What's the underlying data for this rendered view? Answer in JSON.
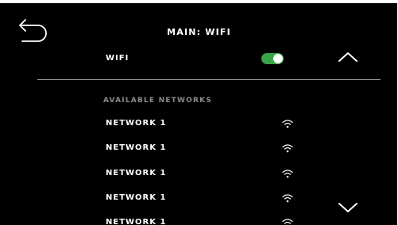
{
  "header": {
    "title": "MAIN: WIFI",
    "back_icon": "back-arrow-icon"
  },
  "wifi_setting": {
    "label": "WIFI",
    "enabled": true,
    "toggle_color": "#3aa545"
  },
  "scroll": {
    "up_icon": "chevron-up-icon",
    "down_icon": "chevron-down-icon"
  },
  "networks": {
    "heading": "AVAILABLE NETWORKS",
    "items": [
      {
        "name": "NETWORK 1",
        "icon": "wifi-icon"
      },
      {
        "name": "NETWORK 1",
        "icon": "wifi-icon"
      },
      {
        "name": "NETWORK 1",
        "icon": "wifi-icon"
      },
      {
        "name": "NETWORK 1",
        "icon": "wifi-icon"
      },
      {
        "name": "NETWORK 1",
        "icon": "wifi-icon"
      }
    ]
  },
  "colors": {
    "background": "#000000",
    "text": "#ffffff",
    "muted_text": "#8c8c8c",
    "divider": "#9a9a9a"
  }
}
